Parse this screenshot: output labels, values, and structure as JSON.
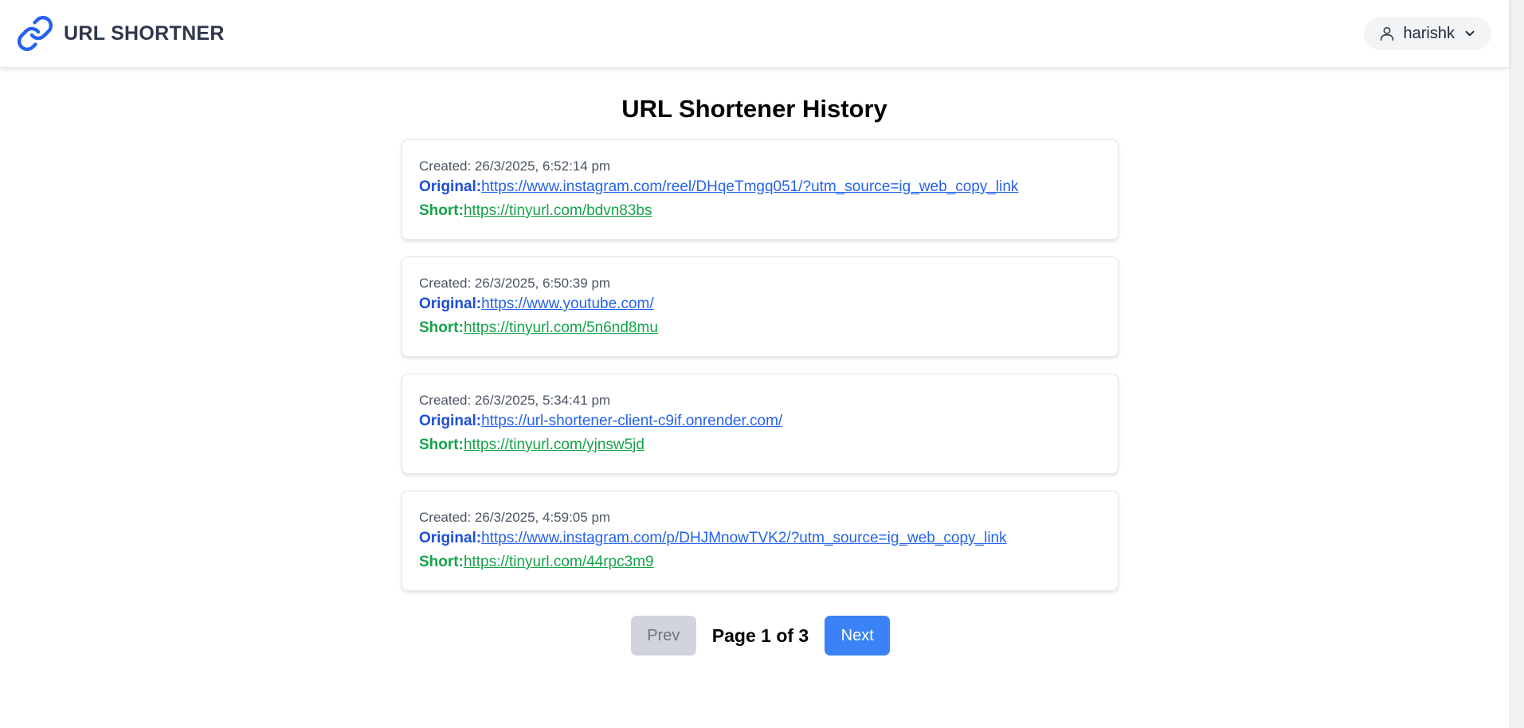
{
  "navbar": {
    "brand": "URL SHORTNER",
    "user": "harishk"
  },
  "main": {
    "title": "URL Shortener History",
    "original_label": "Original:",
    "short_label": "Short:",
    "items": [
      {
        "created": "Created: 26/3/2025, 6:52:14 pm",
        "original": "https://www.instagram.com/reel/DHqeTmgq051/?utm_source=ig_web_copy_link",
        "short": "https://tinyurl.com/bdvn83bs"
      },
      {
        "created": "Created: 26/3/2025, 6:50:39 pm",
        "original": "https://www.youtube.com/",
        "short": "https://tinyurl.com/5n6nd8mu"
      },
      {
        "created": "Created: 26/3/2025, 5:34:41 pm",
        "original": "https://url-shortener-client-c9if.onrender.com/",
        "short": "https://tinyurl.com/yjnsw5jd"
      },
      {
        "created": "Created: 26/3/2025, 4:59:05 pm",
        "original": "https://www.instagram.com/p/DHJMnowTVK2/?utm_source=ig_web_copy_link",
        "short": "https://tinyurl.com/44rpc3m9"
      }
    ]
  },
  "pagination": {
    "prev": "Prev",
    "page_info": "Page 1 of 3",
    "next": "Next"
  },
  "colors": {
    "brand_icon": "#2563eb",
    "original": "#2563eb",
    "short": "#16a34a",
    "next_button": "#3b82f6",
    "prev_button_disabled": "#d1d5db"
  },
  "icons": {
    "brand": "link-icon",
    "user": "user-icon",
    "dropdown": "chevron-down-icon"
  }
}
